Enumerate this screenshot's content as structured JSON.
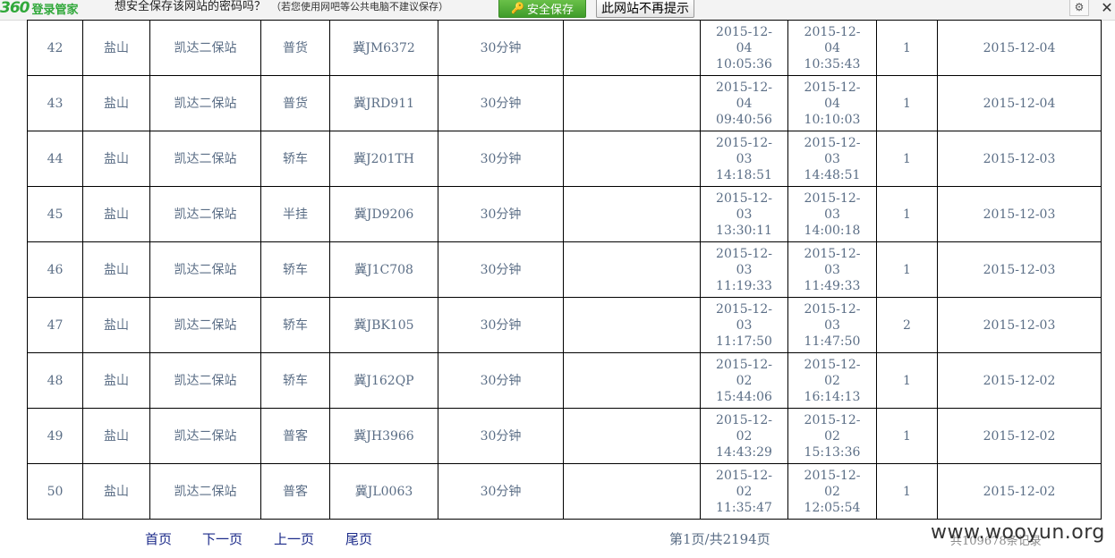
{
  "pwbar": {
    "brand_num": "360",
    "brand_text": "登录管家",
    "prompt": "想安全保存该网站的密码吗？",
    "hint": "（若您使用网吧等公共电脑不建议保存）",
    "save_label": "安全保存",
    "never_label": "此网站不再提示",
    "gear_icon": "⚙",
    "close_icon": "✕"
  },
  "rows": [
    {
      "no": "42",
      "port": "盐山",
      "site": "凯达二保站",
      "type": "普货",
      "plate": "冀JM6372",
      "dur": "30分钟",
      "note": "",
      "in": [
        "2015-12-",
        "04",
        "10:05:36"
      ],
      "out": [
        "2015-12-",
        "04",
        "10:35:43"
      ],
      "cnt": "1",
      "date": "2015-12-04"
    },
    {
      "no": "43",
      "port": "盐山",
      "site": "凯达二保站",
      "type": "普货",
      "plate": "冀JRD911",
      "dur": "30分钟",
      "note": "",
      "in": [
        "2015-12-",
        "04",
        "09:40:56"
      ],
      "out": [
        "2015-12-",
        "04",
        "10:10:03"
      ],
      "cnt": "1",
      "date": "2015-12-04"
    },
    {
      "no": "44",
      "port": "盐山",
      "site": "凯达二保站",
      "type": "轿车",
      "plate": "冀J201TH",
      "dur": "30分钟",
      "note": "",
      "in": [
        "2015-12-",
        "03",
        "14:18:51"
      ],
      "out": [
        "2015-12-",
        "03",
        "14:48:51"
      ],
      "cnt": "1",
      "date": "2015-12-03"
    },
    {
      "no": "45",
      "port": "盐山",
      "site": "凯达二保站",
      "type": "半挂",
      "plate": "冀JD9206",
      "dur": "30分钟",
      "note": "",
      "in": [
        "2015-12-",
        "03",
        "13:30:11"
      ],
      "out": [
        "2015-12-",
        "03",
        "14:00:18"
      ],
      "cnt": "1",
      "date": "2015-12-03"
    },
    {
      "no": "46",
      "port": "盐山",
      "site": "凯达二保站",
      "type": "轿车",
      "plate": "冀J1C708",
      "dur": "30分钟",
      "note": "",
      "in": [
        "2015-12-",
        "03",
        "11:19:33"
      ],
      "out": [
        "2015-12-",
        "03",
        "11:49:33"
      ],
      "cnt": "1",
      "date": "2015-12-03"
    },
    {
      "no": "47",
      "port": "盐山",
      "site": "凯达二保站",
      "type": "轿车",
      "plate": "冀JBK105",
      "dur": "30分钟",
      "note": "",
      "in": [
        "2015-12-",
        "03",
        "11:17:50"
      ],
      "out": [
        "2015-12-",
        "03",
        "11:47:50"
      ],
      "cnt": "2",
      "date": "2015-12-03"
    },
    {
      "no": "48",
      "port": "盐山",
      "site": "凯达二保站",
      "type": "轿车",
      "plate": "冀J162QP",
      "dur": "30分钟",
      "note": "",
      "in": [
        "2015-12-",
        "02",
        "15:44:06"
      ],
      "out": [
        "2015-12-",
        "02",
        "16:14:13"
      ],
      "cnt": "1",
      "date": "2015-12-02"
    },
    {
      "no": "49",
      "port": "盐山",
      "site": "凯达二保站",
      "type": "普客",
      "plate": "冀JH3966",
      "dur": "30分钟",
      "note": "",
      "in": [
        "2015-12-",
        "02",
        "14:43:29"
      ],
      "out": [
        "2015-12-",
        "02",
        "15:13:36"
      ],
      "cnt": "1",
      "date": "2015-12-02"
    },
    {
      "no": "50",
      "port": "盐山",
      "site": "凯达二保站",
      "type": "普客",
      "plate": "冀JL0063",
      "dur": "30分钟",
      "note": "",
      "in": [
        "2015-12-",
        "02",
        "11:35:47"
      ],
      "out": [
        "2015-12-",
        "02",
        "12:05:54"
      ],
      "cnt": "1",
      "date": "2015-12-02"
    }
  ],
  "pager": {
    "first": "首页",
    "next": "下一页",
    "prev": "上一页",
    "last": "尾页",
    "info": "第1页/共2194页",
    "total": "共109678条记录"
  },
  "watermark": "www.wooyun.org",
  "colors": {
    "cell_text": "#5b6e86",
    "link": "#1c2b8a",
    "brand_green": "#30a83a"
  }
}
